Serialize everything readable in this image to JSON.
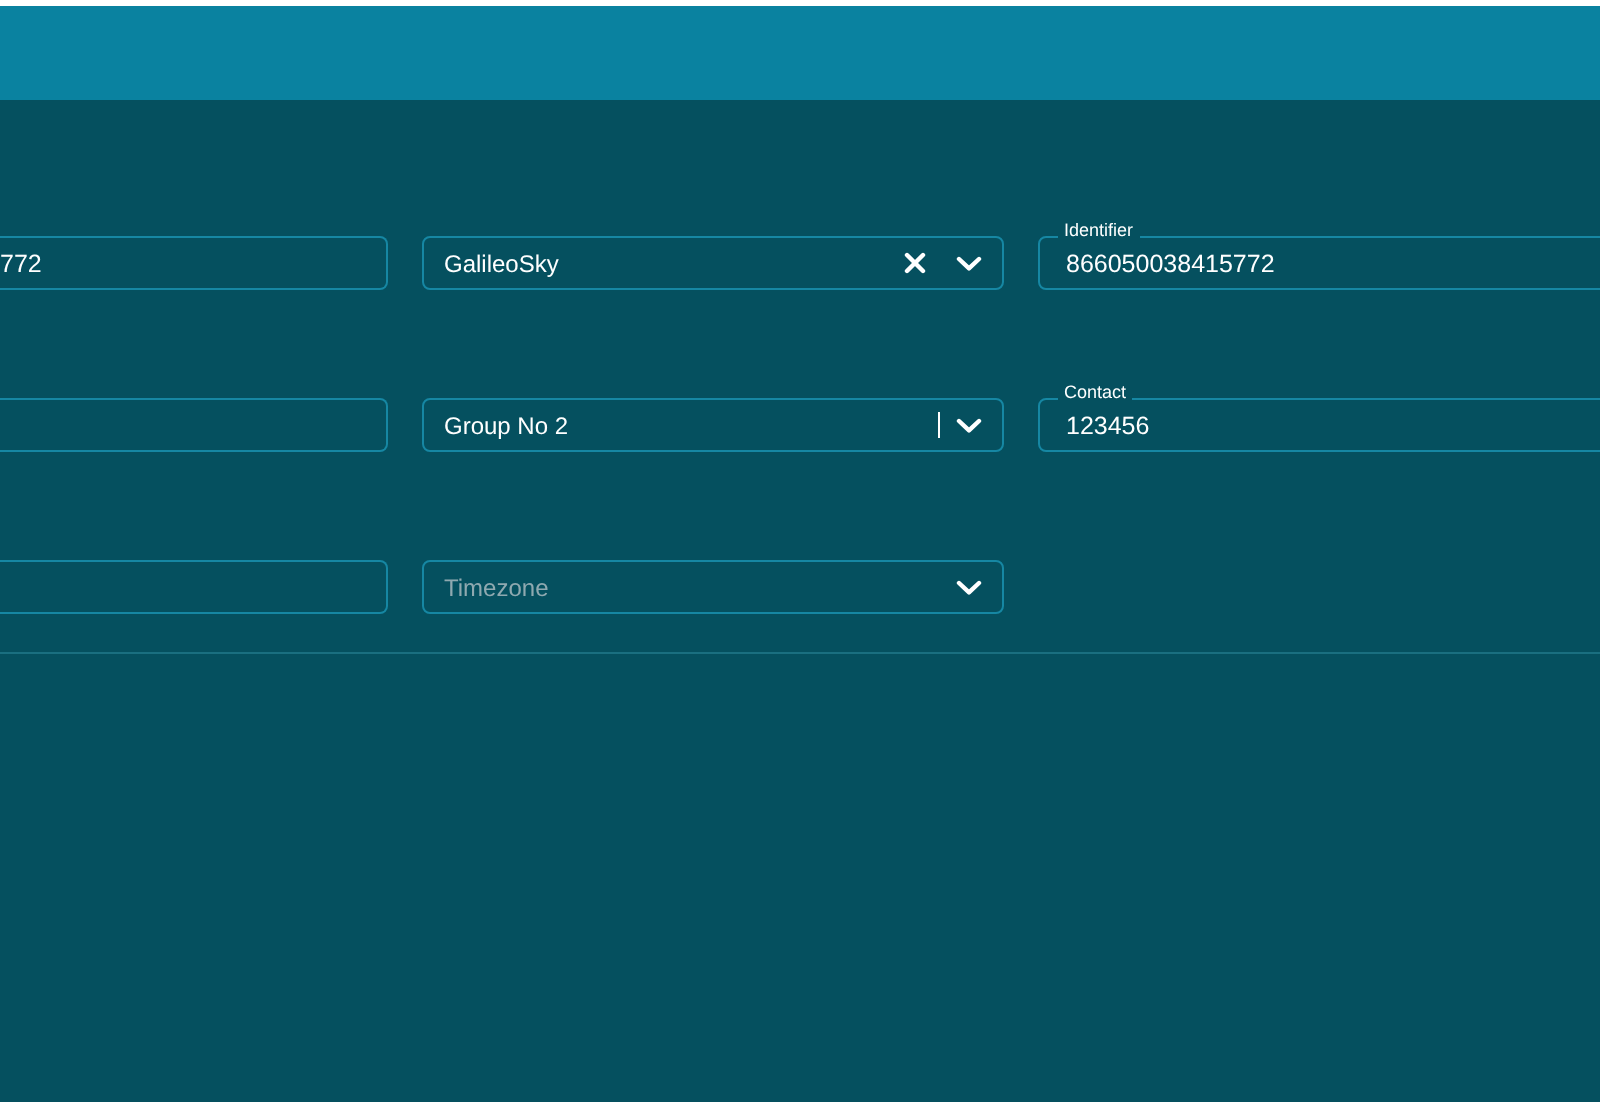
{
  "rows": [
    [
      {
        "kind": "text",
        "value": "772"
      },
      {
        "kind": "select",
        "value": "GalileoSky",
        "clearable": true,
        "separator": false
      },
      {
        "kind": "text",
        "label": "Identifier",
        "value": "866050038415772"
      }
    ],
    [
      {
        "kind": "text"
      },
      {
        "kind": "select",
        "value": "Group No 2",
        "clearable": false,
        "separator": true
      },
      {
        "kind": "text",
        "label": "Contact",
        "value": "123456"
      }
    ],
    [
      {
        "kind": "text"
      },
      {
        "kind": "select",
        "placeholder": "Timezone",
        "clearable": false,
        "separator": false
      }
    ]
  ]
}
